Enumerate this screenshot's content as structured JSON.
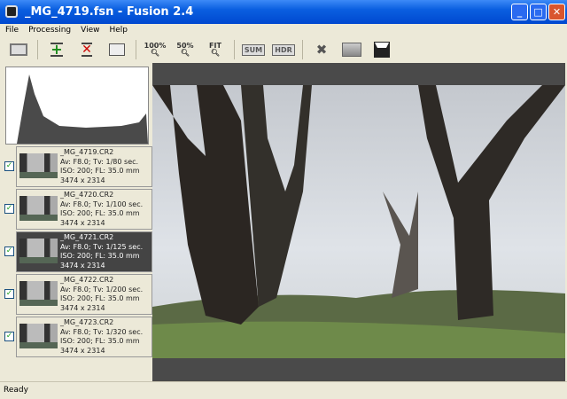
{
  "window": {
    "title": "_MG_4719.fsn - Fusion 2.4",
    "minimize": "_",
    "maximize": "□",
    "close": "✕"
  },
  "menu": [
    "File",
    "Processing",
    "View",
    "Help"
  ],
  "toolbar": {
    "zoom100": "100%",
    "zoom50": "50%",
    "fit": "FIT",
    "sum": "SUM",
    "hdr": "HDR"
  },
  "images": [
    {
      "name": "_MG_4719.CR2",
      "exposure": "Av: F8.0; Tv: 1/80 sec.",
      "iso": "ISO: 200; FL: 35.0 mm",
      "size": "3474 x 2314",
      "checked": true,
      "selected": false
    },
    {
      "name": "_MG_4720.CR2",
      "exposure": "Av: F8.0; Tv: 1/100 sec.",
      "iso": "ISO: 200; FL: 35.0 mm",
      "size": "3474 x 2314",
      "checked": true,
      "selected": false
    },
    {
      "name": "_MG_4721.CR2",
      "exposure": "Av: F8.0; Tv: 1/125 sec.",
      "iso": "ISO: 200; FL: 35.0 mm",
      "size": "3474 x 2314",
      "checked": true,
      "selected": true
    },
    {
      "name": "_MG_4722.CR2",
      "exposure": "Av: F8.0; Tv: 1/200 sec.",
      "iso": "ISO: 200; FL: 35.0 mm",
      "size": "3474 x 2314",
      "checked": true,
      "selected": false
    },
    {
      "name": "_MG_4723.CR2",
      "exposure": "Av: F8.0; Tv: 1/320 sec.",
      "iso": "ISO: 200; FL: 35.0 mm",
      "size": "3474 x 2314",
      "checked": true,
      "selected": false
    }
  ],
  "status": "Ready"
}
